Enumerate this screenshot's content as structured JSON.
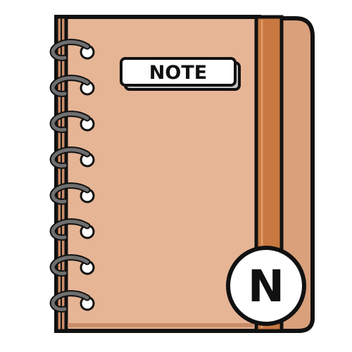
{
  "notebook": {
    "label": "NOTE",
    "badge_letter": "N",
    "rings": 8,
    "colors": {
      "cover": "#e6b595",
      "cover_back": "#d9a07c",
      "spine": "#c98c68",
      "strap": "#c87840",
      "outline": "#111111",
      "ring": "#6f6f6f",
      "label_bg": "#ffffff",
      "label_shadow": "#c8c8c8",
      "badge_bg": "#ffffff"
    }
  }
}
